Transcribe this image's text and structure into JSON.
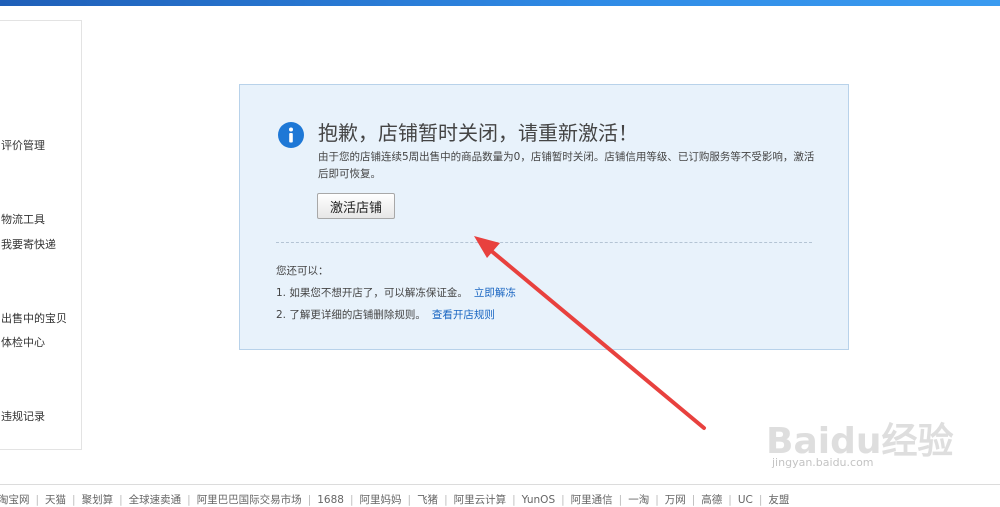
{
  "sidebar": {
    "items": [
      {
        "label": "评价管理"
      },
      {
        "label": "物流工具"
      },
      {
        "label": "我要寄快递"
      },
      {
        "label": "出售中的宝贝"
      },
      {
        "label": "体检中心"
      },
      {
        "label": "违规记录"
      }
    ]
  },
  "notice": {
    "title": "抱歉，店铺暂时关闭，请重新激活！",
    "description": "由于您的店铺连续5周出售中的商品数量为0，店铺暂时关闭。店铺信用等级、已订购服务等不受影响，激活后即可恢复。",
    "activate_label": "激活店铺",
    "also_label": "您还可以：",
    "options": [
      {
        "text": "1. 如果您不想开店了，可以解冻保证金。",
        "link": "立即解冻"
      },
      {
        "text": "2. 了解更详细的店铺删除规则。",
        "link": "查看开店规则"
      }
    ]
  },
  "footer": {
    "links": [
      "淘宝网",
      "天猫",
      "聚划算",
      "全球速卖通",
      "阿里巴巴国际交易市场",
      "1688",
      "阿里妈妈",
      "飞猪",
      "阿里云计算",
      "YunOS",
      "阿里通信",
      "一淘",
      "万网",
      "高德",
      "UC",
      "友盟"
    ]
  },
  "watermark": {
    "brand": "Baidu经验",
    "url": "jingyan.baidu.com"
  },
  "colors": {
    "accent": "#1e78d6",
    "panel_bg": "#e8f2fb",
    "arrow": "#e8413e"
  }
}
